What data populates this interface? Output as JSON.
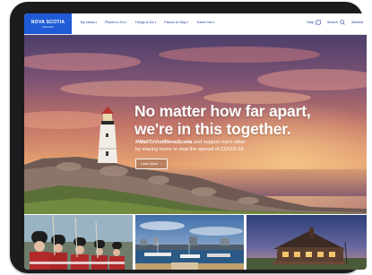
{
  "brand": {
    "name": "NOVA SCOTIA",
    "tagline": "CANADA"
  },
  "nav": {
    "items": [
      {
        "label": "Top Ideas"
      },
      {
        "label": "Places to Go"
      },
      {
        "label": "Things to Do"
      },
      {
        "label": "Places to Stay"
      },
      {
        "label": "Travel Info"
      }
    ],
    "utility": {
      "map": "Map",
      "search": "Search",
      "wishlist": "Wishlist"
    }
  },
  "hero": {
    "headline_line1": "No matter how far apart,",
    "headline_line2": "we're in this together.",
    "hashtag": "#WaitToVisitNovaScotia",
    "body_line1_rest": " and support each other",
    "body_line2": "by staying home to stop the spread of COVID-19.",
    "cta": "Learn More"
  },
  "colors": {
    "brand_blue": "#1f5bd6",
    "nav_text": "#1a3f9a"
  },
  "icons": [
    "map-icon",
    "search-icon",
    "chevron-down-icon",
    "chevron-right-icon"
  ]
}
